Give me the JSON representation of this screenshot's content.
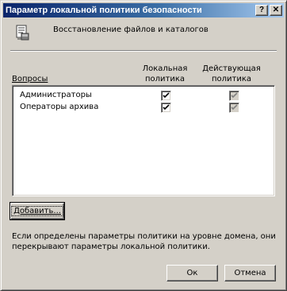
{
  "window": {
    "title": "Параметр локальной политики безопасности",
    "help_label": "?",
    "close_label": "✕"
  },
  "header": {
    "icon": "policy-document-icon",
    "text": "Восстановление файлов и каталогов"
  },
  "columns": {
    "group": "Вопросы",
    "local_line1": "Локальная",
    "local_line2": "политика",
    "effective_line1": "Действующая",
    "effective_line2": "политика"
  },
  "rows": [
    {
      "name": "Администраторы",
      "local_checked": true,
      "effective_checked": true
    },
    {
      "name": "Операторы архива",
      "local_checked": true,
      "effective_checked": true
    }
  ],
  "buttons": {
    "add": "Добавить...",
    "ok": "Ок",
    "cancel": "Отмена"
  },
  "note": {
    "line1": "Если определены параметры политики на уровне домена, они",
    "line2": "перекрывают параметры локальной политики."
  },
  "colors": {
    "face": "#d4d0c8",
    "title_start": "#0a246a",
    "title_end": "#a6caf0"
  }
}
